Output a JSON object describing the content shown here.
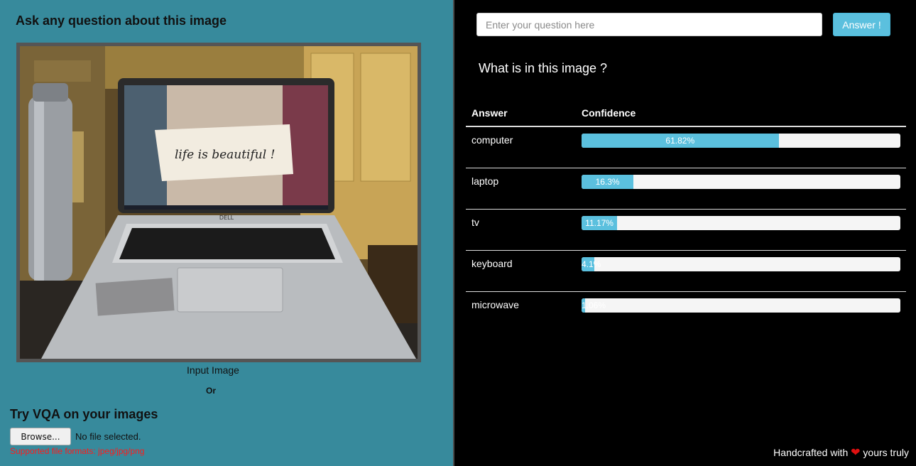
{
  "left_panel": {
    "title": "Ask any question about this image",
    "image_caption": "Input Image",
    "or_text": "Or",
    "upload_title": "Try VQA on your images",
    "browse_label": "Browse...",
    "file_status": "No file selected.",
    "formats_note": "Supported file formats: jpeg/jpg/png",
    "image_text": {
      "screen_message": "life is beautiful !",
      "brand": "DELL"
    }
  },
  "right_panel": {
    "question_placeholder": "Enter your question here",
    "answer_button_label": "Answer !",
    "question": "What is in this image ?",
    "table_headers": {
      "answer": "Answer",
      "confidence": "Confidence"
    },
    "results": [
      {
        "answer": "computer",
        "confidence": 61.82,
        "label": "61.82%"
      },
      {
        "answer": "laptop",
        "confidence": 16.3,
        "label": "16.3%"
      },
      {
        "answer": "tv",
        "confidence": 11.17,
        "label": "11.17%"
      },
      {
        "answer": "keyboard",
        "confidence": 4.1,
        "label": "4.1%"
      },
      {
        "answer": "microwave",
        "confidence": 1.06,
        "label": "1.06%"
      }
    ],
    "footer": {
      "prefix": "Handcrafted with",
      "suffix": "yours truly",
      "icon": "heart-icon"
    }
  },
  "colors": {
    "left_bg": "#378a9c",
    "right_bg": "#000000",
    "accent": "#5bc0de",
    "warning": "#ff1a1a",
    "heart": "#e01010"
  }
}
